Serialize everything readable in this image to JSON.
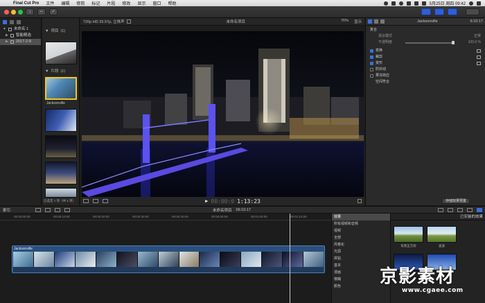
{
  "menubar": {
    "app": "Final Cut Pro",
    "items": [
      "文件",
      "编辑",
      "修剪",
      "标记",
      "片段",
      "修改",
      "显示",
      "窗口",
      "帮助"
    ],
    "clock": "5月25日 周四  09:42"
  },
  "toolbar": {
    "import_label": "↓",
    "keywords_label": "⌐",
    "done_label": "✓"
  },
  "libraries": {
    "items": [
      {
        "label": "未命名 1"
      },
      {
        "label": "智能精选"
      },
      {
        "label": "2017-2-8"
      }
    ]
  },
  "browser": {
    "projects_header": "项目",
    "projects_count": "(1)",
    "clips_header": "片段",
    "clips_count": "(1)",
    "selected_clip_label": "Jacksonville",
    "footer": "已选定 1 项（共 2 项）"
  },
  "viewer": {
    "format": "720p HD 29.97p, 立体声",
    "title": "未命名项目",
    "zoom": "76%",
    "view_menu": "显示",
    "timecode": "1:13:23"
  },
  "inspector": {
    "clip_name": "Jacksonville",
    "timecode": "6:10:17",
    "section": "复合",
    "blend_mode_label": "混合模式",
    "blend_mode_value": "正常",
    "opacity_label": "不透明度",
    "opacity_value": "100.0 %",
    "rows": [
      {
        "label": "变换",
        "checked": true
      },
      {
        "label": "裁剪",
        "checked": true
      },
      {
        "label": "变形",
        "checked": true
      },
      {
        "label": "防抖动",
        "checked": false
      },
      {
        "label": "果冻效应",
        "checked": false
      },
      {
        "label": "空间符合",
        "checked": false
      }
    ],
    "save_preset": "存储效果预置"
  },
  "timeline": {
    "index_label": "索引",
    "project_name": "未命名项目",
    "duration": "06:10:17",
    "clip_label": "Jacksonville",
    "ruler_ticks": [
      "00:00:00:00",
      "00:00:10:00",
      "00:00:20:00",
      "00:00:30:00",
      "00:00:40:00",
      "00:00:50:00",
      "00:01:00:00",
      "00:01:10:00"
    ]
  },
  "effects": {
    "header": "已安装的效果",
    "categories": [
      "效果",
      "所有视频和音频",
      "视频",
      "全部",
      "风格化",
      "光源",
      "拼贴",
      "基本",
      "漫画",
      "模糊",
      "颜色"
    ],
    "selected_index": 0,
    "tiles": [
      {
        "label": "背景正方形"
      },
      {
        "label": "滤波"
      },
      {
        "label": ""
      },
      {
        "label": ""
      }
    ]
  },
  "watermark": {
    "brand": "京影素材",
    "url": "www.cgaee.com"
  },
  "colors": {
    "accent": "#2f5fd6",
    "selection": "#f3c623",
    "clip": "#2a4f7c"
  }
}
